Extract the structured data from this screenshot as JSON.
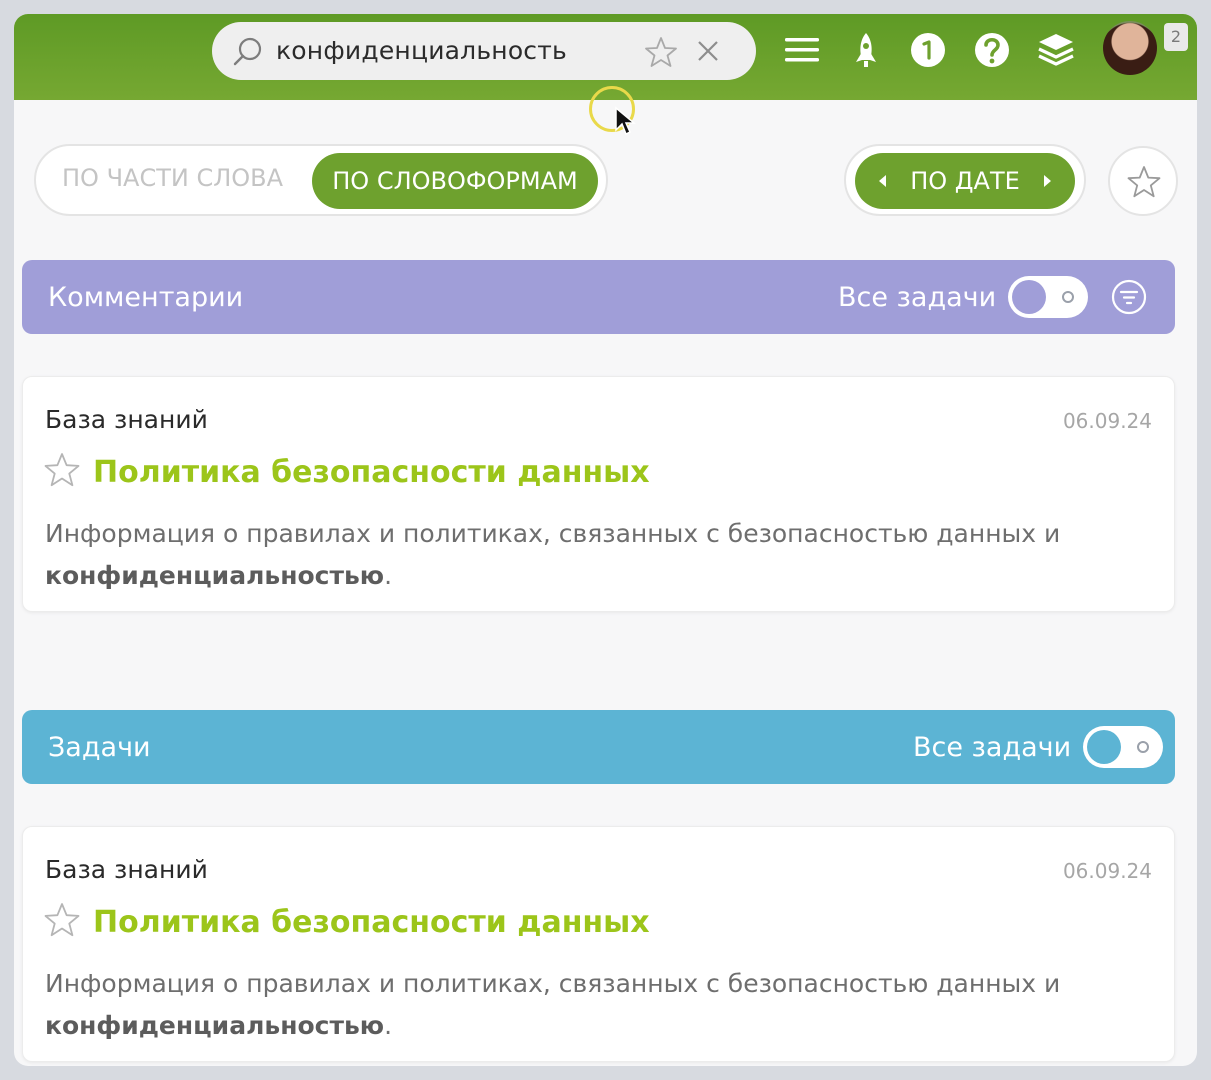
{
  "header": {
    "search_query": "конфиденциальность",
    "notification_count": "2",
    "icons": [
      "search-icon",
      "star-icon",
      "close-icon",
      "menu-icon",
      "rocket-icon",
      "clock-icon",
      "help-icon",
      "layers-icon"
    ],
    "accent": "#6ea12e"
  },
  "search_mode": {
    "partial_label": "ПО ЧАСТИ СЛОВА",
    "wordforms_label": "ПО СЛОВОФОРМАМ",
    "selected": "ПО СЛОВОФОРМАМ"
  },
  "sort": {
    "label": "ПО ДАТЕ"
  },
  "sections": [
    {
      "title": "Комментарии",
      "all_tasks_label": "Все задачи",
      "color": "#a09ed8",
      "results": [
        {
          "category": "База знаний",
          "date": "06.09.24",
          "title": "Политика безопасности данных",
          "text_before": "Информация о правилах и политиках, связанных с безопасностью данных и",
          "text_highlight": "конфиденциальностью",
          "text_after": "."
        }
      ]
    },
    {
      "title": "Задачи",
      "all_tasks_label": "Все задачи",
      "color": "#5cb4d4",
      "results": [
        {
          "category": "База знаний",
          "date": "06.09.24",
          "title": "Политика безопасности данных",
          "text_before": "Информация о правилах и политиках, связанных с безопасностью данных и",
          "text_highlight": "конфиденциальностью",
          "text_after": "."
        }
      ]
    }
  ]
}
